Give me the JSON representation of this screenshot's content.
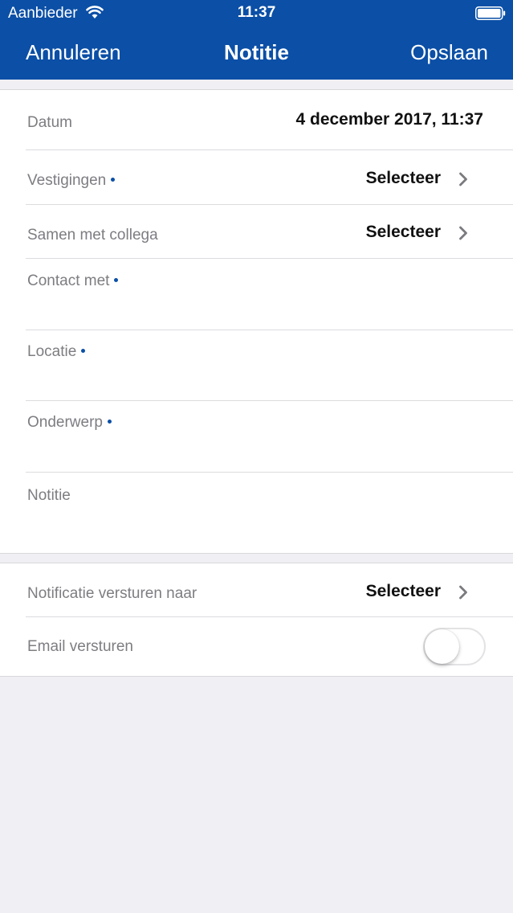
{
  "status_bar": {
    "carrier": "Aanbieder",
    "time": "11:37"
  },
  "nav": {
    "cancel_label": "Annuleren",
    "title": "Notitie",
    "save_label": "Opslaan"
  },
  "form": {
    "date": {
      "label": "Datum",
      "value": "4 december 2017, 11:37"
    },
    "branches": {
      "label": "Vestigingen",
      "value": "Selecteer",
      "required": true
    },
    "colleague": {
      "label": "Samen met collega",
      "value": "Selecteer"
    },
    "contact": {
      "label": "Contact met",
      "required": true
    },
    "location": {
      "label": "Locatie",
      "required": true
    },
    "subject": {
      "label": "Onderwerp",
      "required": true
    },
    "note": {
      "label": "Notitie"
    }
  },
  "notifications": {
    "send_to": {
      "label": "Notificatie versturen naar",
      "value": "Selecteer"
    },
    "email": {
      "label": "Email versturen",
      "enabled": false
    }
  },
  "colors": {
    "brand": "#0b4fa6",
    "background": "#efeff4",
    "label": "#7d7d82"
  }
}
